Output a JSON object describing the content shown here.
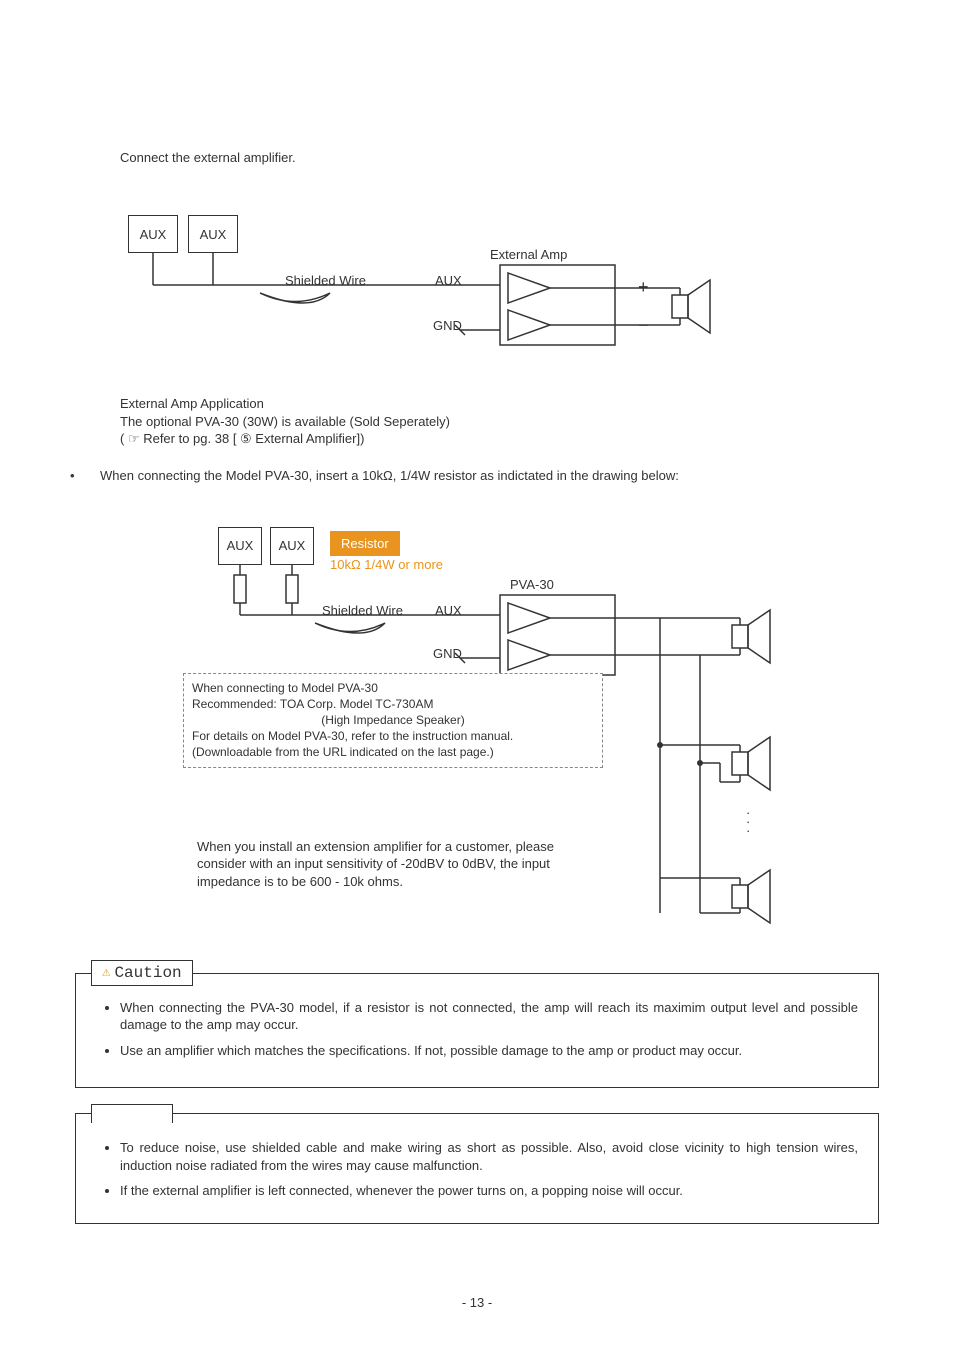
{
  "intro": "Connect the external amplifier.",
  "diagram1": {
    "aux1": "AUX",
    "aux2": "AUX",
    "shielded": "Shielded Wire",
    "aux_in": "AUX",
    "gnd": "GND",
    "external_amp": "External Amp",
    "plus": "+",
    "minus": "−",
    "app_title": "External Amp Application",
    "app_line2": "The optional PVA-30 (30W) is available (Sold Seperately)",
    "app_line3": "( ☞ Refer to pg. 38 [ ⑤ External Amplifier])"
  },
  "bullet1": "When connecting the Model PVA-30, insert a 10kΩ, 1/4W resistor as indictated in the drawing below:",
  "diagram2": {
    "aux1": "AUX",
    "aux2": "AUX",
    "resistor_label": "Resistor",
    "resistor_spec": "10kΩ 1/4W or more",
    "shielded": "Shielded Wire",
    "aux_in": "AUX",
    "gnd": "GND",
    "pva": "PVA-30",
    "dashed_l1": "When connecting to Model PVA-30",
    "dashed_l2": "Recommended: TOA Corp. Model TC-730AM",
    "dashed_l3": "(High Impedance Speaker)",
    "dashed_l4": "For details on Model PVA-30, refer to the instruction manual.",
    "dashed_l5": "(Downloadable from the URL indicated on the last page.)",
    "note_text": "When you install an extension amplifier for a customer, please consider with an input sensitivity of -20dBV to 0dBV, the input impedance is to be 600 - 10k ohms."
  },
  "caution": {
    "label": "Caution",
    "item1": "When connecting the PVA-30 model, if a resistor is not connected, the amp will reach its maximim output level and possible damage to the amp may occur.",
    "item2": "Use an amplifier which matches the specifications.  If not, possible damage to the amp or product may occur."
  },
  "note_box": {
    "item1": "To reduce noise, use shielded cable and make wiring as short as possible.  Also, avoid close vicinity to high tension wires, induction noise radiated from the wires may cause malfunction.",
    "item2": "If the external amplifier is left connected, whenever the power turns on, a popping noise will occur."
  },
  "page_num": "- 13 -"
}
